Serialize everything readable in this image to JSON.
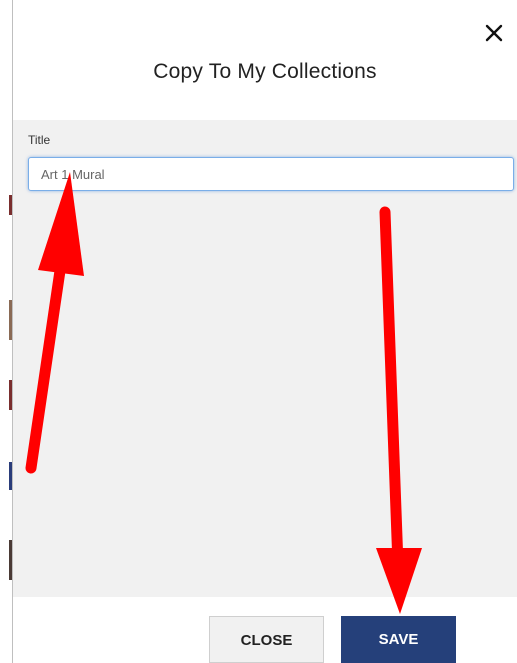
{
  "dialog": {
    "title": "Copy To My Collections",
    "close_icon": "close-icon"
  },
  "form": {
    "title_label": "Title",
    "title_value": "Art 1 Mural"
  },
  "footer": {
    "close_label": "CLOSE",
    "save_label": "SAVE"
  },
  "colors": {
    "save_button": "#25407a",
    "annotation_arrow": "#ff0000",
    "input_focus_border": "#7aaee8",
    "body_background": "#f1f1f1"
  }
}
